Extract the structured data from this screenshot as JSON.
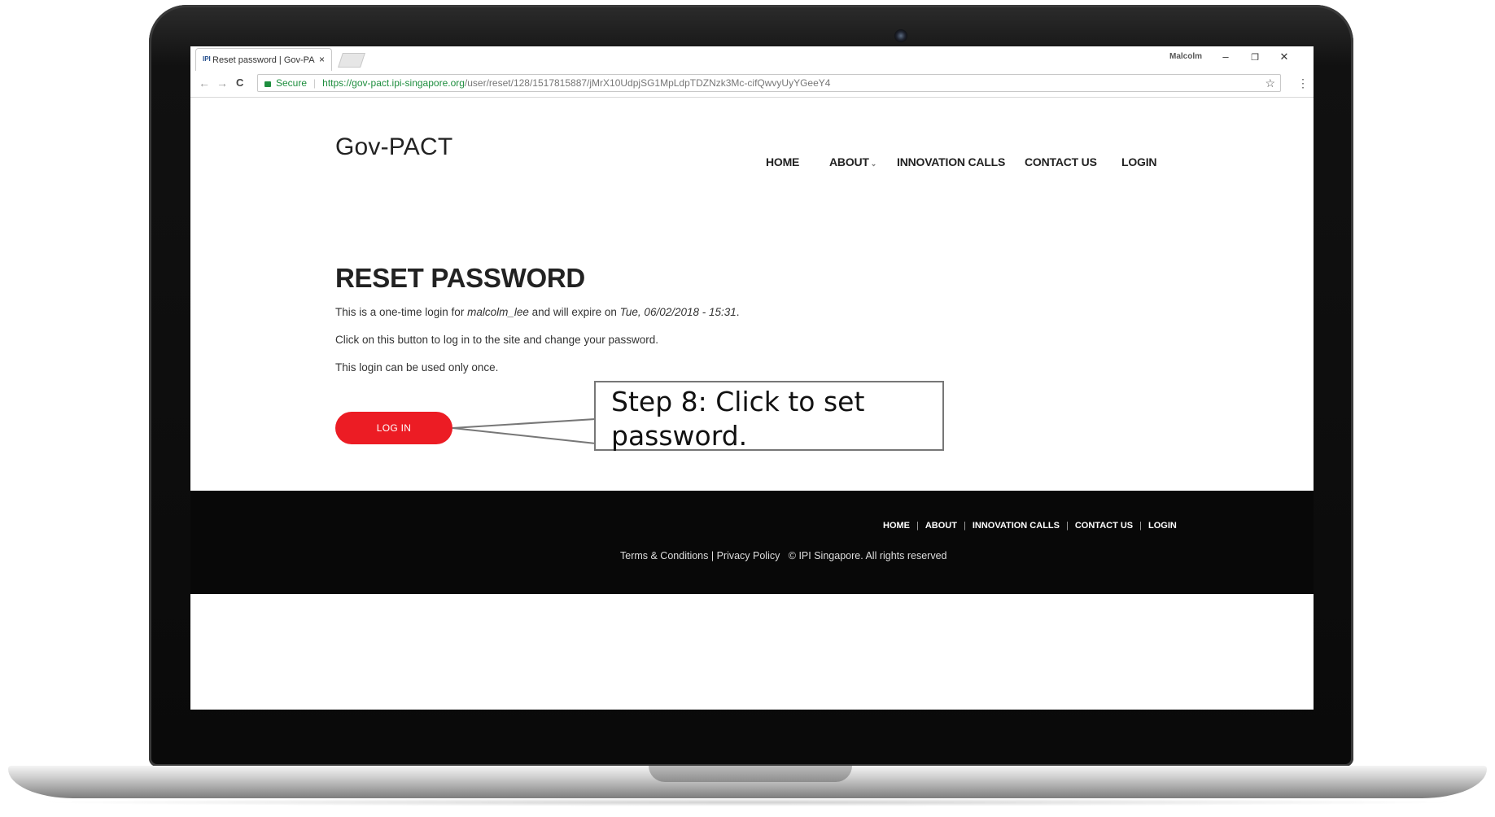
{
  "browser": {
    "tab_title": "Reset password | Gov-PA",
    "favicon_text": "IPI",
    "tab_close": "×",
    "profile_name": "Malcolm",
    "window_controls": {
      "minimize": "–",
      "restore": "❐",
      "close": "✕"
    },
    "nav": {
      "back": "←",
      "forward": "→",
      "reload": "C"
    },
    "secure_label": "Secure",
    "url_domain": "https://gov-pact.ipi-singapore.org",
    "url_path": "/user/reset/128/1517815887/jMrX10UdpjSG1MpLdpTDZNzk3Mc-cifQwvyUyYGeeY4",
    "bookmark_icon": "☆",
    "menu_icon": "⋮"
  },
  "header": {
    "logo": "Gov-PACT",
    "nav": [
      "HOME",
      "ABOUT",
      "INNOVATION CALLS",
      "CONTACT US",
      "LOGIN"
    ],
    "about_caret": "⌄"
  },
  "main": {
    "title": "RESET PASSWORD",
    "line1_prefix": "This is a one-time login for ",
    "line1_user": "malcolm_lee",
    "line1_middle": " and will expire on ",
    "line1_expiry": "Tue, 06/02/2018 - 15:31",
    "line1_suffix": ".",
    "line2": "Click on this button to log in to the site and change your password.",
    "line3": "This login can be used only once.",
    "login_button": "LOG IN"
  },
  "footer": {
    "links": [
      "HOME",
      "ABOUT",
      "INNOVATION CALLS",
      "CONTACT US",
      "LOGIN"
    ],
    "separator": "|",
    "copyright": "Terms & Conditions | Privacy Policy   © IPI Singapore. All rights reserved"
  },
  "callout": {
    "line1": "Step 8: Click to set",
    "line2": "password."
  },
  "colors": {
    "accent": "#ec1c24",
    "footer_bg": "#080808",
    "secure_green": "#1e8e3e"
  }
}
